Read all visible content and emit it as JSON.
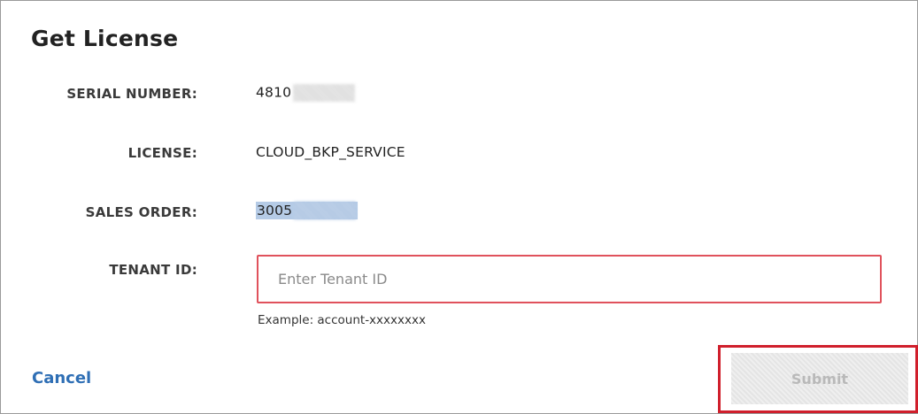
{
  "dialog": {
    "title": "Get License"
  },
  "fields": {
    "serial_number": {
      "label": "SERIAL NUMBER:",
      "value": "4810"
    },
    "license": {
      "label": "LICENSE:",
      "value": "CLOUD_BKP_SERVICE"
    },
    "sales_order": {
      "label": "SALES ORDER:",
      "value": "3005"
    },
    "tenant_id": {
      "label": "TENANT ID:",
      "value": "",
      "placeholder": "Enter Tenant ID",
      "hint": "Example: account-xxxxxxxx",
      "border_color": "#e0525c"
    }
  },
  "actions": {
    "cancel_label": "Cancel",
    "submit_label": "Submit",
    "submit_disabled": true
  },
  "colors": {
    "link": "#2f6fb5",
    "annotation_frame": "#d01f2c",
    "selection_highlight": "#b5cbe6"
  }
}
